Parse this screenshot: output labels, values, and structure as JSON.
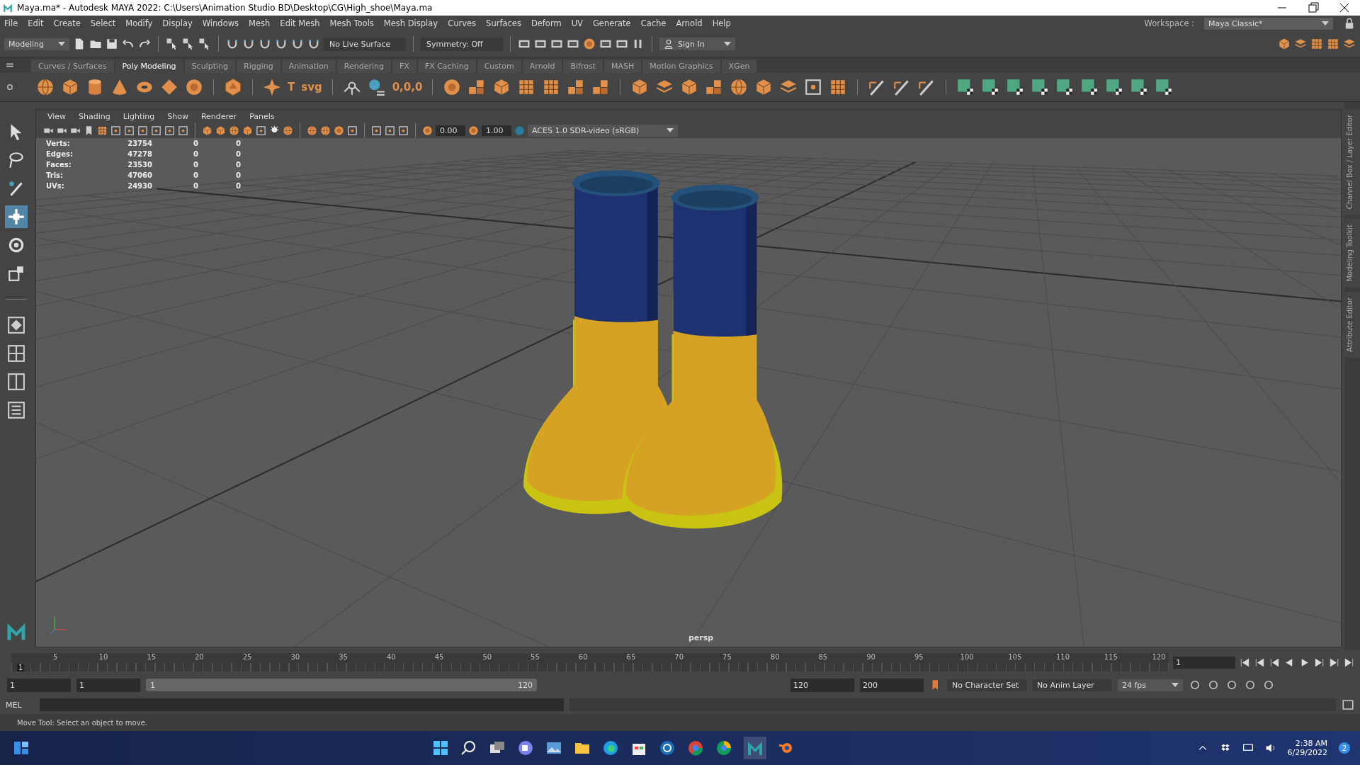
{
  "window": {
    "title": "Maya.ma* - Autodesk MAYA 2022: C:\\Users\\Animation Studio BD\\Desktop\\CG\\High_shoe\\Maya.ma"
  },
  "menu_bar": [
    "File",
    "Edit",
    "Create",
    "Select",
    "Modify",
    "Display",
    "Windows",
    "Mesh",
    "Edit Mesh",
    "Mesh Tools",
    "Mesh Display",
    "Curves",
    "Surfaces",
    "Deform",
    "UV",
    "Generate",
    "Cache",
    "Arnold",
    "Help"
  ],
  "workspace": {
    "label": "Workspace :",
    "value": "Maya Classic*"
  },
  "status_line": {
    "menu_set": "Modeling",
    "live_surface": "No Live Surface",
    "symmetry": "Symmetry: Off",
    "sign_in": "Sign In"
  },
  "shelf_tabs": [
    {
      "label": "Curves / Surfaces",
      "selected": false
    },
    {
      "label": "Poly Modeling",
      "selected": true
    },
    {
      "label": "Sculpting",
      "selected": false
    },
    {
      "label": "Rigging",
      "selected": false
    },
    {
      "label": "Animation",
      "selected": false
    },
    {
      "label": "Rendering",
      "selected": false
    },
    {
      "label": "FX",
      "selected": false
    },
    {
      "label": "FX Caching",
      "selected": false
    },
    {
      "label": "Custom",
      "selected": false
    },
    {
      "label": "Arnold",
      "selected": false
    },
    {
      "label": "Bifrost",
      "selected": false
    },
    {
      "label": "MASH",
      "selected": false
    },
    {
      "label": "Motion Graphics",
      "selected": false
    },
    {
      "label": "XGen",
      "selected": false
    }
  ],
  "shelf_labels": [
    "T",
    "svg",
    "0,0,0"
  ],
  "viewport": {
    "menu": [
      "View",
      "Shading",
      "Lighting",
      "Show",
      "Renderer",
      "Panels"
    ],
    "exposure": "0.00",
    "gamma": "1.00",
    "color_space": "ACES 1.0 SDR-video (sRGB)",
    "hud": [
      {
        "label": "Verts:",
        "values": [
          "23754",
          "0",
          "0"
        ]
      },
      {
        "label": "Edges:",
        "values": [
          "47278",
          "0",
          "0"
        ]
      },
      {
        "label": "Faces:",
        "values": [
          "23530",
          "0",
          "0"
        ]
      },
      {
        "label": "Tris:",
        "values": [
          "47060",
          "0",
          "0"
        ]
      },
      {
        "label": "UVs:",
        "values": [
          "24930",
          "0",
          "0"
        ]
      }
    ],
    "camera": "persp"
  },
  "side_tabs": [
    "Channel Box / Layer Editor",
    "Modeling Toolkit",
    "Attribute Editor"
  ],
  "timeline": {
    "ticks": [
      "5",
      "10",
      "15",
      "20",
      "25",
      "30",
      "35",
      "40",
      "45",
      "50",
      "55",
      "60",
      "65",
      "70",
      "75",
      "80",
      "85",
      "90",
      "95",
      "100",
      "105",
      "110",
      "115",
      "120"
    ],
    "marker": "1",
    "level": 0,
    "current_frame": "1"
  },
  "range": {
    "level": 1,
    "start": "1",
    "playback_start": "1",
    "slider_start": "1",
    "slider_end": "120",
    "playback_end": "120",
    "end": "200",
    "character_set": "No Character Set",
    "anim_layer": "No Anim Layer",
    "fps": "24 fps"
  },
  "command_line": {
    "language": "MEL"
  },
  "help_line": "Move Tool: Select an object to move.",
  "taskbar": {
    "time": "2:38 AM",
    "date": "6/29/2022",
    "notifications": "2"
  }
}
